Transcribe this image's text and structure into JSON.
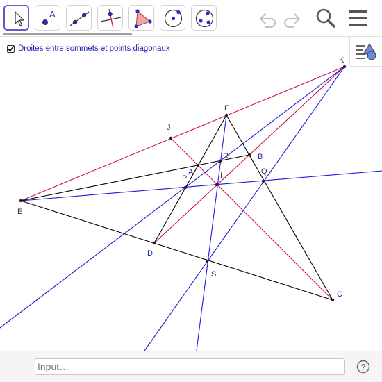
{
  "toolbar": {
    "tools": [
      {
        "id": "move",
        "icon": "pointer-icon",
        "active": true
      },
      {
        "id": "point",
        "icon": "point-icon",
        "label": "A"
      },
      {
        "id": "line",
        "icon": "line-icon"
      },
      {
        "id": "perpendicular",
        "icon": "perpendicular-line-icon"
      },
      {
        "id": "polygon",
        "icon": "polygon-icon"
      },
      {
        "id": "circle-center",
        "icon": "circle-center-point-icon"
      },
      {
        "id": "circle-3pts",
        "icon": "circle-three-points-icon"
      }
    ],
    "undo_icon": "undo-icon",
    "redo_icon": "redo-icon",
    "search_icon": "search-icon",
    "menu_icon": "hamburger-menu-icon",
    "point_tool_letter": "A"
  },
  "checkbox": {
    "label": "Droites entre sommets et points diagonaux",
    "checked": true
  },
  "colors": {
    "red": "#d0104c",
    "blue": "#1c1cd6",
    "black": "#000000",
    "label_blue": "#1f1fb0",
    "label_dark": "#333333"
  },
  "points": {
    "K": "K",
    "F": "F",
    "J": "J",
    "R": "R",
    "B": "B",
    "A": "A",
    "P": "P",
    "I": "I",
    "Q": "Q",
    "E": "E",
    "D": "D",
    "S": "S",
    "C": "C"
  },
  "input_bar": {
    "placeholder": "Input…",
    "help_icon": "help-icon"
  }
}
